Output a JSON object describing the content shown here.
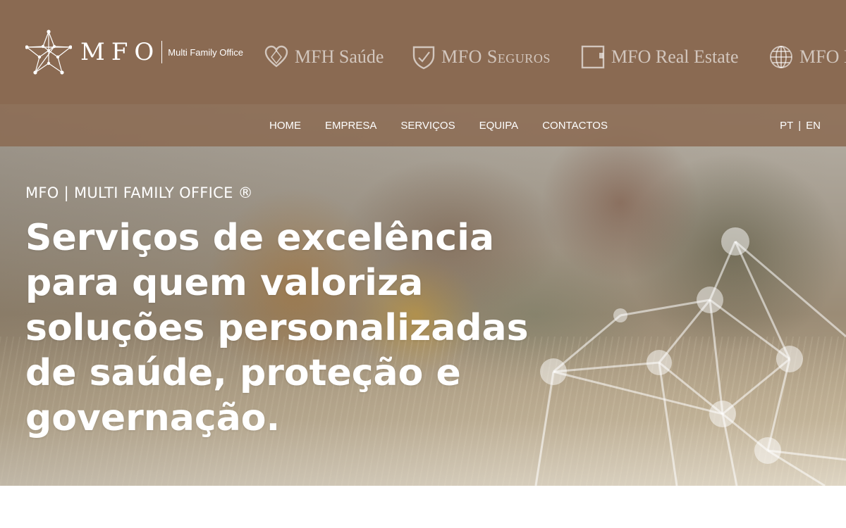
{
  "header": {
    "logo": {
      "mark": "MFO",
      "tagline": "Multi Family Office"
    },
    "brands": [
      {
        "icon": "heart-icon",
        "name": "MFH Saúde"
      },
      {
        "icon": "shield-icon",
        "name": "MFO Seguros"
      },
      {
        "icon": "building-icon",
        "name": "MFO Real Estate"
      },
      {
        "icon": "globe-icon",
        "name": "MFO I"
      }
    ]
  },
  "nav": {
    "items": [
      "HOME",
      "EMPRESA",
      "SERVIÇOS",
      "EQUIPA",
      "CONTACTOS"
    ],
    "languages": {
      "pt": "PT",
      "separator": "|",
      "en": "EN"
    }
  },
  "hero": {
    "kicker": "MFO | MULTI FAMILY OFFICE ®",
    "title": "Serviços de excelência para quem valoriza soluções personalizadas de saúde, proteção e governação."
  },
  "colors": {
    "brand_brown": "#8a6a52",
    "text_on_brand": "#ffffff"
  }
}
